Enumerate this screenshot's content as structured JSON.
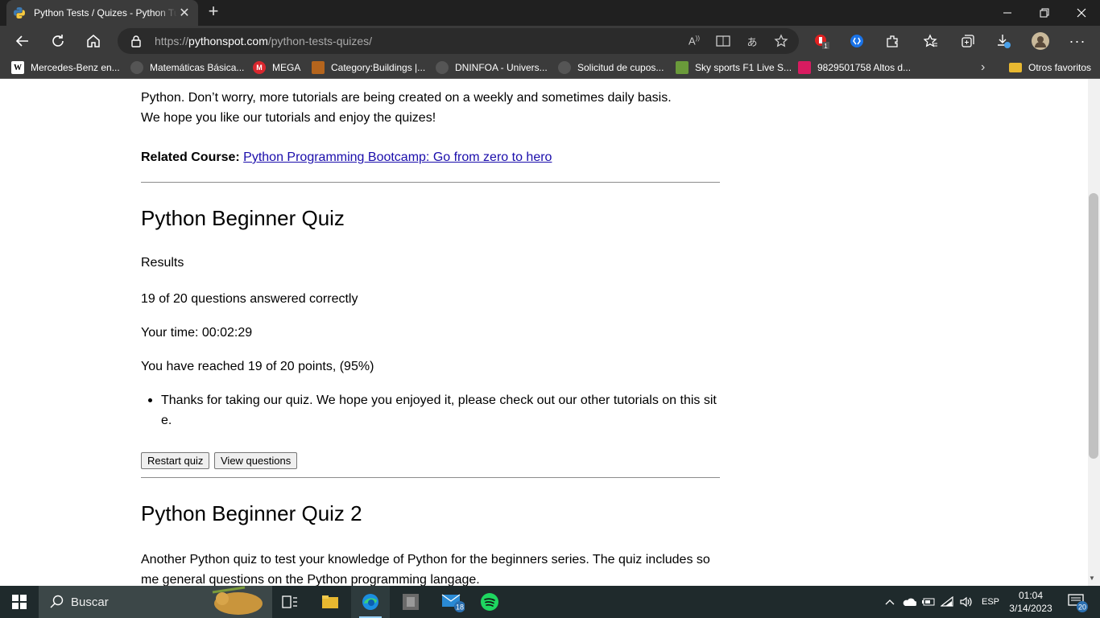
{
  "browser": {
    "tab_title": "Python Tests / Quizes - Python Tutorial",
    "url_scheme": "https://",
    "url_domain": "pythonspot.com",
    "url_path": "/python-tests-quizes/",
    "notification_badge": "1"
  },
  "bookmarks": {
    "items": [
      {
        "label": "Mercedes-Benz en...",
        "icon": "wikipedia-icon"
      },
      {
        "label": "Matemáticas Básica...",
        "icon": "site-icon"
      },
      {
        "label": "MEGA",
        "icon": "mega-icon"
      },
      {
        "label": "Category:Buildings |...",
        "icon": "image-icon"
      },
      {
        "label": "DNINFOA - Univers...",
        "icon": "site-icon"
      },
      {
        "label": "Solicitud de cupos...",
        "icon": "site-icon"
      },
      {
        "label": "Sky sports F1 Live S...",
        "icon": "tv-icon"
      },
      {
        "label": "9829501758 Altos d...",
        "icon": "listing-icon"
      }
    ],
    "other_favorites": "Otros favoritos"
  },
  "article": {
    "intro_line1": "Python. Don’t worry, more tutorials are being created on a weekly and sometimes daily basis.",
    "intro_line2": "We hope you like our tutorials and enjoy the quizes!",
    "related_label": "Related Course:",
    "related_link": "Python Programming Bootcamp: Go from zero to hero",
    "quiz1": {
      "title": "Python Beginner Quiz",
      "results_label": "Results",
      "score_text": "19 of 20 questions answered correctly",
      "time_text": "Your time: 00:02:29",
      "points_text": "You have reached 19 of 20 points, (95%)",
      "thanks_text": "Thanks for taking our quiz. We hope you enjoyed it, please check out our other tutorials on this site.",
      "restart_button": "Restart quiz",
      "view_button": "View questions"
    },
    "quiz2": {
      "title": "Python Beginner Quiz 2",
      "description": "Another Python quiz to test your knowledge of Python for the beginners series. The quiz includes some general questions on the Python programming langage."
    }
  },
  "taskbar": {
    "search_placeholder": "Buscar",
    "mail_badge": "18",
    "language": "ESP",
    "time": "01:04",
    "date": "3/14/2023",
    "notifications_count": "20"
  }
}
